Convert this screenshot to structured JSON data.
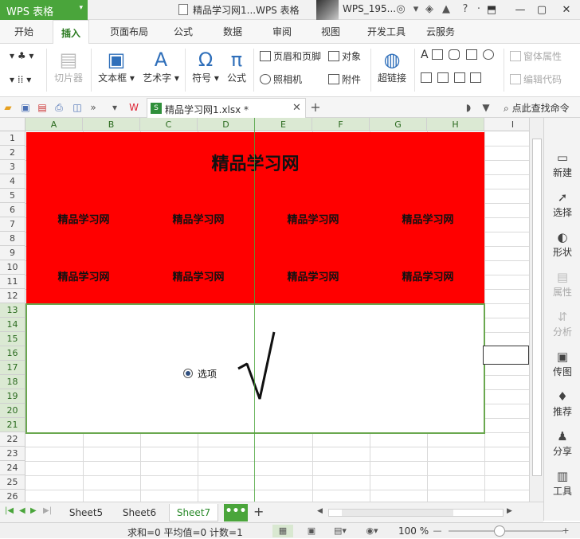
{
  "titlebar": {
    "app_name": "WPS 表格",
    "doc_title": "精品学习网1...WPS 表格",
    "user_name": "WPS_195..."
  },
  "menu": {
    "tabs": [
      "开始",
      "插入",
      "页面布局",
      "公式",
      "数据",
      "审阅",
      "视图",
      "开发工具",
      "云服务"
    ],
    "active": "插入"
  },
  "ribbon": {
    "slicer": "切片器",
    "textbox": "文本框",
    "wordart": "艺术字",
    "symbol": "符号",
    "formula": "公式",
    "header_footer": "页眉和页脚",
    "object": "对象",
    "camera": "照相机",
    "attachment": "附件",
    "hyperlink": "超链接",
    "form_props": "窗体属性",
    "edit_code": "编辑代码"
  },
  "tabrow": {
    "file_name": "精品学习网1.xlsx *",
    "search_cmd": "点此查找命令"
  },
  "sheet": {
    "columns": [
      "A",
      "B",
      "C",
      "D",
      "E",
      "F",
      "G",
      "H",
      "I"
    ],
    "rows": [
      "1",
      "2",
      "3",
      "4",
      "5",
      "6",
      "7",
      "8",
      "9",
      "10",
      "11",
      "12",
      "13",
      "14",
      "15",
      "16",
      "17",
      "18",
      "19",
      "20",
      "21",
      "22",
      "23",
      "24",
      "25",
      "26"
    ],
    "title": "精品学习网",
    "cells": [
      "精品学习网",
      "精品学习网",
      "精品学习网",
      "精品学习网",
      "精品学习网",
      "精品学习网",
      "精品学习网",
      "精品学习网"
    ],
    "radio_label": "选项",
    "accent_green": "#4aa53b",
    "red_fill": "#ff0000"
  },
  "right_panel": [
    "新建",
    "选择",
    "形状",
    "属性",
    "分析",
    "传图",
    "推荐",
    "分享",
    "工具"
  ],
  "sheet_tabs": {
    "tabs": [
      "Sheet5",
      "Sheet6",
      "Sheet7"
    ],
    "active": "Sheet7",
    "more": "•••"
  },
  "status": {
    "text": "求和=0  平均值=0  计数=1",
    "zoom": "100 %"
  }
}
